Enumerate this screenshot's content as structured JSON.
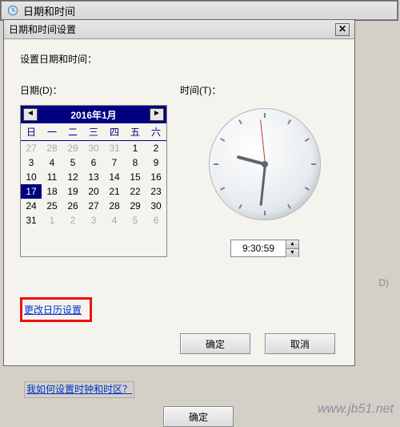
{
  "outer": {
    "title": "日期和时间"
  },
  "dialog": {
    "title": "日期和时间设置",
    "heading": "设置日期和时间：",
    "date_label": "日期(D)：",
    "time_label": "时间(T)：",
    "ok": "确定",
    "cancel": "取消"
  },
  "calendar": {
    "month_title": "2016年1月",
    "prev": "◄",
    "next": "►",
    "weekdays": [
      "日",
      "一",
      "二",
      "三",
      "四",
      "五",
      "六"
    ],
    "days": [
      {
        "d": 27,
        "o": true
      },
      {
        "d": 28,
        "o": true
      },
      {
        "d": 29,
        "o": true
      },
      {
        "d": 30,
        "o": true
      },
      {
        "d": 31,
        "o": true
      },
      {
        "d": 1
      },
      {
        "d": 2
      },
      {
        "d": 3
      },
      {
        "d": 4
      },
      {
        "d": 5
      },
      {
        "d": 6
      },
      {
        "d": 7
      },
      {
        "d": 8
      },
      {
        "d": 9
      },
      {
        "d": 10
      },
      {
        "d": 11
      },
      {
        "d": 12
      },
      {
        "d": 13
      },
      {
        "d": 14
      },
      {
        "d": 15
      },
      {
        "d": 16
      },
      {
        "d": 17,
        "sel": true
      },
      {
        "d": 18
      },
      {
        "d": 19
      },
      {
        "d": 20
      },
      {
        "d": 21
      },
      {
        "d": 22
      },
      {
        "d": 23
      },
      {
        "d": 24
      },
      {
        "d": 25
      },
      {
        "d": 26
      },
      {
        "d": 27
      },
      {
        "d": 28
      },
      {
        "d": 29
      },
      {
        "d": 30
      },
      {
        "d": 31
      },
      {
        "d": 1,
        "o": true
      },
      {
        "d": 2,
        "o": true
      },
      {
        "d": 3,
        "o": true
      },
      {
        "d": 4,
        "o": true
      },
      {
        "d": 5,
        "o": true
      },
      {
        "d": 6,
        "o": true
      }
    ]
  },
  "time": {
    "value": "9:30:59"
  },
  "link": {
    "change_calendar": "更改日历设置"
  },
  "lower": {
    "faq": "我如何设置时钟和时区？",
    "ok2": "确定"
  },
  "partial_label": "D)",
  "watermark": "www.jb51.net"
}
